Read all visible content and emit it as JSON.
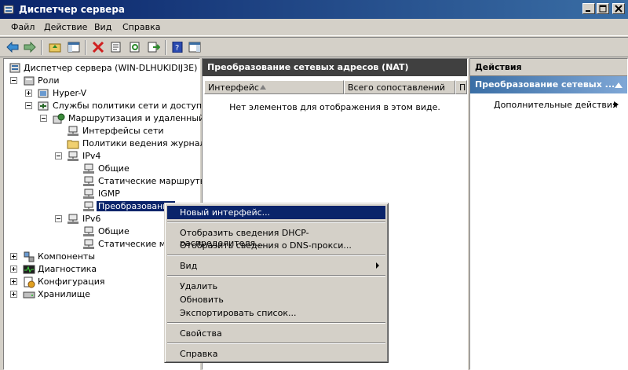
{
  "window": {
    "title": "Диспетчер сервера"
  },
  "menu": [
    "Файл",
    "Действие",
    "Вид",
    "Справка"
  ],
  "tree": {
    "root": "Диспетчер сервера (WIN-DLHUKIDIJ3E)",
    "roles": "Роли",
    "hyperv": "Hyper-V",
    "nps": "Службы политики сети и доступа",
    "rras": "Маршрутизация и удаленный дос",
    "interfaces": "Интерфейсы сети",
    "logging": "Политики ведения журналов",
    "ipv4": "IPv4",
    "ipv4_general": "Общие",
    "static_routes": "Статические маршруты",
    "igmp": "IGMP",
    "nat": "Преобразование",
    "ipv6": "IPv6",
    "ipv6_general": "Общие",
    "ipv6_static": "Статические марш",
    "components": "Компоненты",
    "diagnostics": "Диагностика",
    "configuration": "Конфигурация",
    "storage": "Хранилище"
  },
  "center": {
    "title": "Преобразование сетевых адресов (NAT)",
    "columns": [
      "Интерфейс",
      "Всего сопоставлений",
      "Пр"
    ],
    "empty_message": "Нет элементов для отображения в этом виде."
  },
  "actions": {
    "title": "Действия",
    "section": "Преобразование сетевых ...",
    "more": "Дополнительные действия"
  },
  "context_menu": {
    "new_interface": "Новый интерфейс...",
    "dhcp": "Отобразить сведения DHCP-распределителя...",
    "dns": "Отобразить сведения о DNS-прокси...",
    "view": "Вид",
    "delete": "Удалить",
    "refresh": "Обновить",
    "export": "Экспортировать список...",
    "properties": "Свойства",
    "help": "Справка"
  },
  "colors": {
    "title_bar": "#0a246a",
    "selection": "#0a246a",
    "actions_header": "#3a6ea5"
  }
}
